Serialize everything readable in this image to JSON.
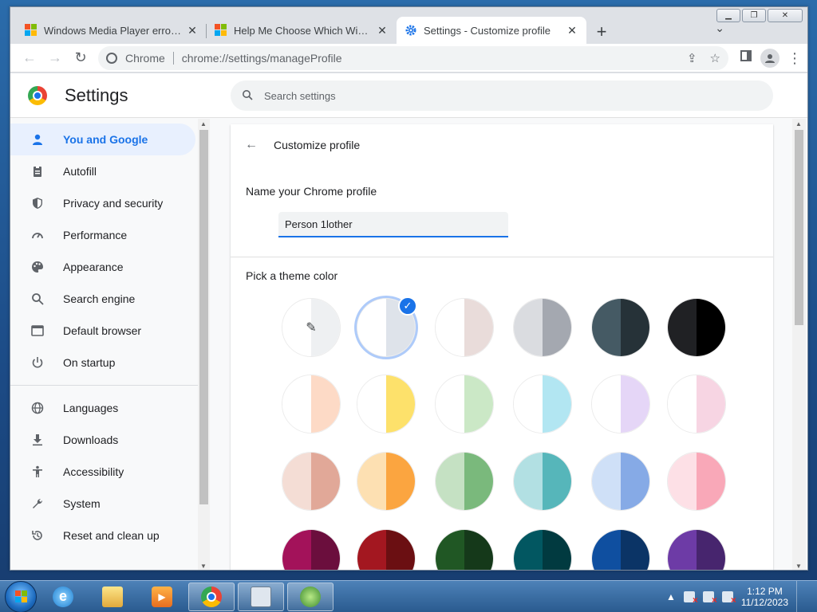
{
  "browser": {
    "tabs": [
      {
        "title": "Windows Media Player errors - M",
        "favicon": "microsoft-logo",
        "active": false
      },
      {
        "title": "Help Me Choose Which Window",
        "favicon": "microsoft-logo",
        "active": false
      },
      {
        "title": "Settings - Customize profile",
        "favicon": "gear-icon",
        "active": true
      }
    ],
    "new_tab": "+",
    "omnibox": {
      "site_label": "Chrome",
      "url": "chrome://settings/manageProfile"
    }
  },
  "settings": {
    "title": "Settings",
    "search_placeholder": "Search settings",
    "sidebar": {
      "group1": [
        {
          "label": "You and Google",
          "icon": "person-icon",
          "active": true
        },
        {
          "label": "Autofill",
          "icon": "clipboard-icon"
        },
        {
          "label": "Privacy and security",
          "icon": "shield-icon"
        },
        {
          "label": "Performance",
          "icon": "gauge-icon"
        },
        {
          "label": "Appearance",
          "icon": "palette-icon"
        },
        {
          "label": "Search engine",
          "icon": "search-icon"
        },
        {
          "label": "Default browser",
          "icon": "browser-icon"
        },
        {
          "label": "On startup",
          "icon": "power-icon"
        }
      ],
      "group2": [
        {
          "label": "Languages",
          "icon": "globe-icon"
        },
        {
          "label": "Downloads",
          "icon": "download-icon"
        },
        {
          "label": "Accessibility",
          "icon": "accessibility-icon"
        },
        {
          "label": "System",
          "icon": "wrench-icon"
        },
        {
          "label": "Reset and clean up",
          "icon": "reset-icon"
        }
      ]
    },
    "content": {
      "header": "Customize profile",
      "name_label": "Name your Chrome profile",
      "name_value": "Person 1lother",
      "theme_label": "Pick a theme color",
      "swatches": [
        [
          [
            "#ffffff",
            "#eef0f2"
          ],
          [
            "#ffffff",
            "#dee3ea"
          ],
          [
            "#ffffff",
            "#e9dcda"
          ],
          [
            "#dadce0",
            "#a4a8b0"
          ],
          [
            "#455a64",
            "#263238"
          ],
          [
            "#202124",
            "#000000"
          ]
        ],
        [
          [
            "#ffffff",
            "#fddac6"
          ],
          [
            "#ffffff",
            "#fde16b"
          ],
          [
            "#ffffff",
            "#cbe8c6"
          ],
          [
            "#ffffff",
            "#b2e6f2"
          ],
          [
            "#ffffff",
            "#e5d6f7"
          ],
          [
            "#ffffff",
            "#f7d5e3"
          ]
        ],
        [
          [
            "#f4ddd5",
            "#e1a898"
          ],
          [
            "#fde0b2",
            "#fba540"
          ],
          [
            "#c5e1c3",
            "#7ab97c"
          ],
          [
            "#b2e0e3",
            "#56b6ba"
          ],
          [
            "#cfe0f7",
            "#86aae6"
          ],
          [
            "#fde0e6",
            "#f9a8b8"
          ]
        ],
        [
          [
            "#a3125a",
            "#6b0e3d"
          ],
          [
            "#a31720",
            "#6b0f12"
          ],
          [
            "#205724",
            "#15391a"
          ],
          [
            "#025761",
            "#013a40"
          ],
          [
            "#0f4fa0",
            "#0b3466"
          ],
          [
            "#6d3ba6",
            "#47256e"
          ]
        ]
      ],
      "selected_row": 0,
      "selected_col": 1,
      "check_mark": "✓",
      "picker_icon": "✎"
    }
  },
  "taskbar": {
    "time": "1:12 PM",
    "date": "11/12/2023"
  }
}
